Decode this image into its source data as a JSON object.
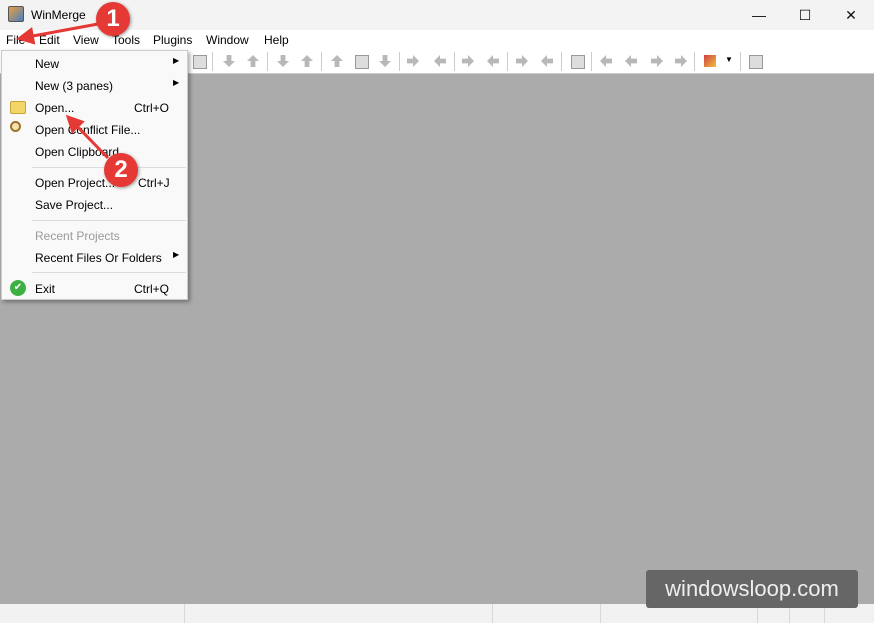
{
  "window": {
    "title": "WinMerge",
    "minimize": "—",
    "maximize": "☐",
    "close": "✕"
  },
  "menubar": [
    "File",
    "Edit",
    "View",
    "Tools",
    "Plugins",
    "Window",
    "Help"
  ],
  "file_menu": {
    "items": [
      {
        "label": "New",
        "shortcut": "",
        "submenu": true
      },
      {
        "label": "New (3 panes)",
        "shortcut": "",
        "submenu": true
      },
      {
        "label": "Open...",
        "shortcut": "Ctrl+O",
        "icon": "folder-icon"
      },
      {
        "label": "Open Conflict File...",
        "shortcut": "",
        "icon": "magnifier-icon"
      },
      {
        "label": "Open Clipboard",
        "shortcut": ""
      },
      {
        "label": "Open Project...",
        "shortcut": "Ctrl+J"
      },
      {
        "label": "Save Project...",
        "shortcut": ""
      },
      {
        "label": "Recent Projects",
        "shortcut": "",
        "disabled": true
      },
      {
        "label": "Recent Files Or Folders",
        "shortcut": "",
        "submenu": true
      },
      {
        "label": "Exit",
        "shortcut": "Ctrl+Q",
        "icon": "check-circle-icon"
      }
    ]
  },
  "annotations": {
    "step1": "1",
    "step2": "2",
    "color": "#e53935"
  },
  "watermark": "windowsloop.com",
  "colors": {
    "workspace": "#ababab",
    "menu_bg": "#f9f9f9"
  }
}
